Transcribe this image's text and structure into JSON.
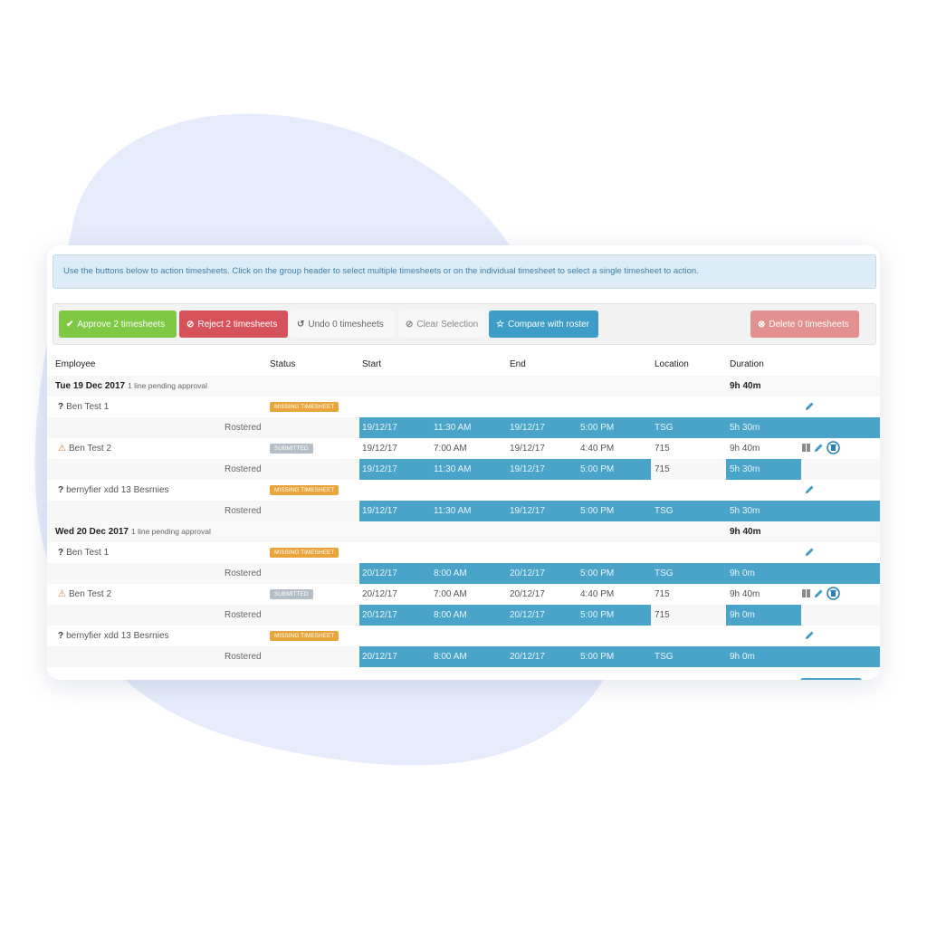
{
  "info_text": "Use the buttons below to action timesheets. Click on the group header to select multiple timesheets or on the individual timesheet to select a single timesheet to action.",
  "toolbar": {
    "approve": "Approve 2 timesheets",
    "reject": "Reject 2 timesheets",
    "undo": "Undo 0 timesheets",
    "clear": "Clear Selection",
    "compare": "Compare with roster",
    "delete": "Delete 0 timesheets"
  },
  "headers": {
    "employee": "Employee",
    "status": "Status",
    "start": "Start",
    "end": "End",
    "location": "Location",
    "duration": "Duration"
  },
  "colors": {
    "approve": "#7ec843",
    "reject": "#d6525a",
    "compare": "#3d9dc6",
    "delete": "#e29090",
    "rostered_bar": "#4aa3c8",
    "missing_badge": "#e9a53b",
    "submitted_badge": "#b5bec6"
  },
  "icons": {
    "missing_status": "question-mark-icon",
    "warning_status": "warning-triangle-icon",
    "edit": "pencil-icon",
    "copy": "copy-icon",
    "delete": "trash-icon"
  },
  "groups": [
    {
      "date": "Tue 19 Dec 2017",
      "pending": "1 line pending approval",
      "duration": "9h 40m",
      "rows": [
        {
          "icon": "?",
          "name": "Ben Test 1",
          "status": "MISSING TIMESHEET",
          "rostered": {
            "label": "Rostered",
            "start_date": "19/12/17",
            "start_time": "11:30 AM",
            "end_date": "19/12/17",
            "end_time": "5:00 PM",
            "location": "TSG",
            "duration": "5h 30m"
          }
        },
        {
          "icon": "⚠",
          "name": "Ben Test 2",
          "status": "SUBMITTED",
          "actual": {
            "start_date": "19/12/17",
            "start_time": "7:00 AM",
            "end_date": "19/12/17",
            "end_time": "4:40 PM",
            "location": "715",
            "duration": "9h 40m"
          },
          "rostered": {
            "label": "Rostered",
            "start_date": "19/12/17",
            "start_time": "11:30 AM",
            "end_date": "19/12/17",
            "end_time": "5:00 PM",
            "location": "715",
            "duration": "5h 30m"
          }
        },
        {
          "icon": "?",
          "name": "bernyfier xdd 13 Besrnies",
          "status": "MISSING TIMESHEET",
          "rostered": {
            "label": "Rostered",
            "start_date": "19/12/17",
            "start_time": "11:30 AM",
            "end_date": "19/12/17",
            "end_time": "5:00 PM",
            "location": "TSG",
            "duration": "5h 30m"
          }
        }
      ]
    },
    {
      "date": "Wed 20 Dec 2017",
      "pending": "1 line pending approval",
      "duration": "9h 40m",
      "rows": [
        {
          "icon": "?",
          "name": "Ben Test 1",
          "status": "MISSING TIMESHEET",
          "rostered": {
            "label": "Rostered",
            "start_date": "20/12/17",
            "start_time": "8:00 AM",
            "end_date": "20/12/17",
            "end_time": "5:00 PM",
            "location": "TSG",
            "duration": "9h 0m"
          }
        },
        {
          "icon": "⚠",
          "name": "Ben Test 2",
          "status": "SUBMITTED",
          "actual": {
            "start_date": "20/12/17",
            "start_time": "7:00 AM",
            "end_date": "20/12/17",
            "end_time": "4:40 PM",
            "location": "715",
            "duration": "9h 40m"
          },
          "rostered": {
            "label": "Rostered",
            "start_date": "20/12/17",
            "start_time": "8:00 AM",
            "end_date": "20/12/17",
            "end_time": "5:00 PM",
            "location": "715",
            "duration": "9h 0m"
          }
        },
        {
          "icon": "?",
          "name": "bernyfier xdd 13 Besrnies",
          "status": "MISSING TIMESHEET",
          "rostered": {
            "label": "Rostered",
            "start_date": "20/12/17",
            "start_time": "8:00 AM",
            "end_date": "20/12/17",
            "end_time": "5:00 PM",
            "location": "TSG",
            "duration": "9h 0m"
          }
        }
      ]
    }
  ]
}
